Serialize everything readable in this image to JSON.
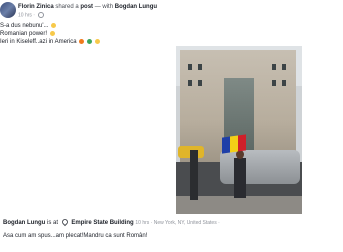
{
  "header": {
    "author": "Florin Zinica",
    "shared_text": "shared a",
    "post_word": "post",
    "with_text": "— with",
    "tagged": "Bogdan Lungu",
    "time": "10 hrs ·"
  },
  "post_lines": [
    "S-a dus nebunu'...",
    "Romanian power!",
    "Ieri in Kiseleff..azi in America"
  ],
  "colors": {
    "emoji_laugh": "#f7c94a",
    "emoji_fire": "#f07a1c",
    "emoji_check": "#3ba55d",
    "emoji_smile": "#f7c94a",
    "flag_blue": "#1e3fa8",
    "flag_yellow": "#f3cf17",
    "flag_red": "#cf1f2a"
  },
  "checkin": {
    "person": "Bogdan Lungu",
    "is_at": "is at",
    "place": "Empire State Building",
    "meta": "10 hrs · New York, NY, United States ·"
  },
  "caption": "Asa cum am spus...am plecat!Mandru ca sunt Român!"
}
